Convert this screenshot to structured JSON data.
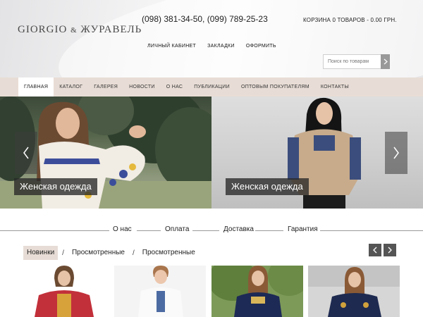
{
  "header": {
    "logo_main": "GIORGIO",
    "logo_amp": "&",
    "logo_second": "ЖУРАВЕЛЬ",
    "phones": "(098) 381-34-50, (099) 789-25-23",
    "cart": "КОРЗИНА 0 ТОВАРОВ - 0.00 ГРН.",
    "links": [
      "ЛИЧНЫЙ КАБИНЕТ",
      "ЗАКЛАДКИ",
      "ОФОРМИТЬ"
    ],
    "search_placeholder": "Поиск по товарам"
  },
  "nav": {
    "items": [
      "ГЛАВНАЯ",
      "КАТАЛОГ",
      "ГАЛЕРЕЯ",
      "НОВОСТИ",
      "О НАС",
      "ПУБЛИКАЦИИ",
      "ОПТОВЫМ ПОКУПАТЕЛЯМ",
      "КОНТАКТЫ"
    ],
    "active_index": 0
  },
  "slider": {
    "slides": [
      {
        "caption": "Женская одежда"
      },
      {
        "caption": "Женская одежда"
      }
    ]
  },
  "info_links": [
    "О нас",
    "Оплата",
    "Доставка",
    "Гарантия"
  ],
  "product_tabs": {
    "tabs": [
      "Новинки",
      "Просмотренные",
      "Просмотренные"
    ],
    "separator": "/",
    "active_index": 0
  },
  "icons": {
    "search": "search-icon",
    "slider_prev": "chevron-left-icon",
    "slider_next": "chevron-right-icon",
    "carousel_prev": "chevron-left-icon",
    "carousel_next": "chevron-right-icon"
  },
  "colors": {
    "nav_background": "#e8ddd6",
    "caption_background": "#282828",
    "arrow_background": "#555555"
  }
}
